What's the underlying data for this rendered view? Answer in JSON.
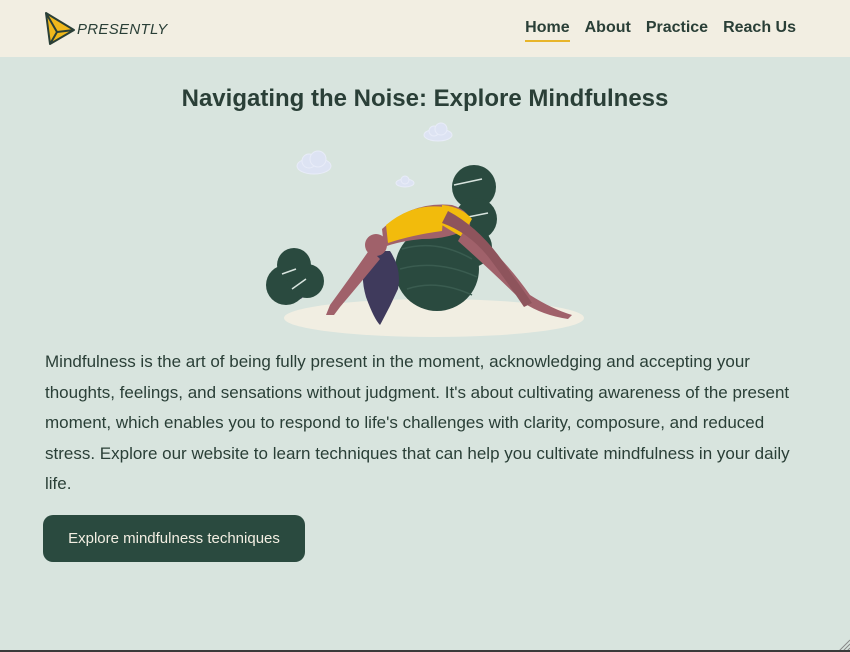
{
  "brand": {
    "name": "PRESENTLY",
    "logo_icon": "paper-plane-logo-icon"
  },
  "nav": {
    "items": [
      {
        "label": "Home",
        "active": true
      },
      {
        "label": "About",
        "active": false
      },
      {
        "label": "Practice",
        "active": false
      },
      {
        "label": "Reach Us",
        "active": false
      }
    ]
  },
  "main": {
    "title": "Navigating the Noise: Explore Mindfulness",
    "hero_image": "woman-stretching-on-exercise-ball-illustration",
    "intro": "Mindfulness is the art of being fully present in the moment, acknowledging and accepting your thoughts, feelings, and sensations without judgment. It's about cultivating awareness of the present moment, which enables you to respond to life's challenges with clarity, composure, and reduced stress. Explore our website to learn techniques that can help you cultivate mindfulness in your daily life.",
    "cta_label": "Explore mindfulness techniques"
  },
  "colors": {
    "header_bg": "#f2eee2",
    "page_bg": "#d8e4de",
    "text": "#2a3f37",
    "accent": "#e8b52a",
    "button_bg": "#2a4a3f",
    "button_text": "#f2eee2"
  }
}
